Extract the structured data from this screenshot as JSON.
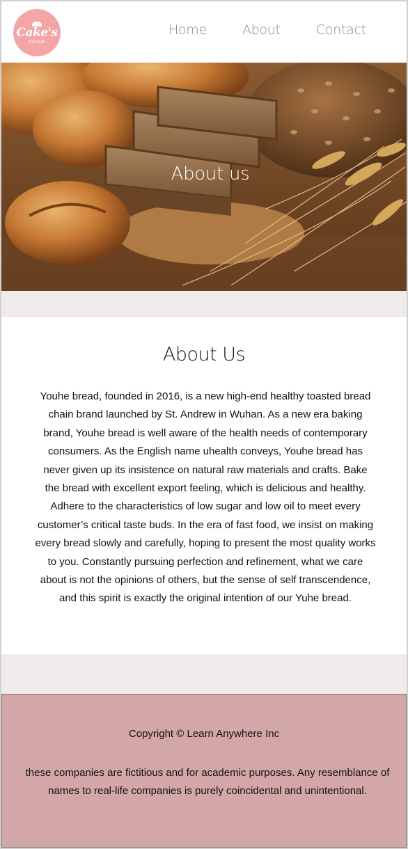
{
  "header": {
    "logo": {
      "word": "Cake's",
      "sub": "DREAM"
    },
    "nav": [
      {
        "label": "Home"
      },
      {
        "label": "About"
      },
      {
        "label": "Contact"
      }
    ]
  },
  "hero": {
    "title": "About us"
  },
  "about": {
    "heading": "About Us",
    "body": "Youhe bread, founded in 2016, is a new high-end healthy toasted bread chain brand launched by St. Andrew in Wuhan. As a new era baking brand, Youhe bread is well aware of the health needs of contemporary consumers. As the English name uhealth conveys, Youhe bread has never given up its insistence on natural raw materials and crafts. Bake the bread with excellent export feeling, which is delicious and healthy. Adhere to the characteristics of low sugar and low oil to meet every customer’s critical taste buds. In the era of fast food, we insist on making every bread slowly and carefully, hoping to present the most quality works to you. Constantly pursuing perfection and refinement, what we care about is not the opinions of others, but the sense of self transcendence, and this spirit is exactly the original intention of our Yuhe bread."
  },
  "footer": {
    "copyright": "Copyright © Learn Anywhere Inc",
    "disclaimer": "these companies are fictitious and for academic purposes. Any resemblance of names to real-life companies is purely coincidental and unintentional."
  },
  "colors": {
    "logo_bg": "#f4a6a6",
    "nav_text": "#8a8a8a",
    "band_grey": "#efebeb",
    "footer_bg": "#d3a7a7"
  }
}
